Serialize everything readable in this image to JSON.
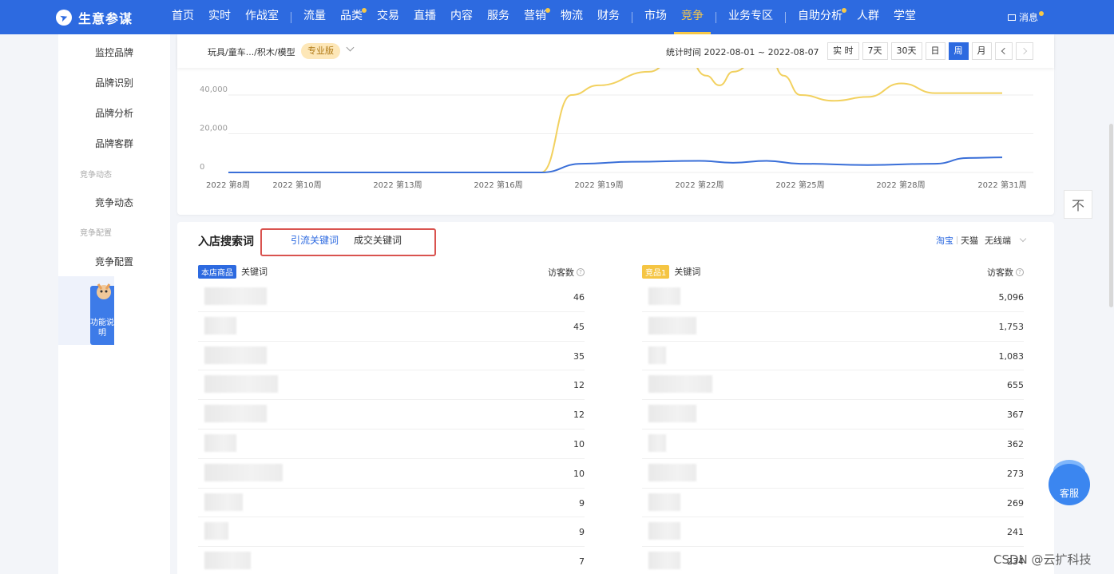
{
  "app": {
    "title": "生意参谋",
    "logo_icon": "compass-icon"
  },
  "nav": {
    "items": [
      {
        "label": "首页",
        "dot": false
      },
      {
        "label": "实时",
        "dot": false
      },
      {
        "label": "作战室",
        "dot": false
      },
      {
        "sep": true
      },
      {
        "label": "流量",
        "dot": false
      },
      {
        "label": "品类",
        "dot": true
      },
      {
        "label": "交易",
        "dot": false
      },
      {
        "label": "直播",
        "dot": false
      },
      {
        "label": "内容",
        "dot": false
      },
      {
        "label": "服务",
        "dot": false
      },
      {
        "label": "营销",
        "dot": true
      },
      {
        "label": "物流",
        "dot": false
      },
      {
        "label": "财务",
        "dot": false
      },
      {
        "sep": true
      },
      {
        "label": "市场",
        "dot": false
      },
      {
        "label": "竞争",
        "dot": false,
        "active": true
      },
      {
        "sep": true
      },
      {
        "label": "业务专区",
        "dot": false
      },
      {
        "sep": true
      },
      {
        "label": "自助分析",
        "dot": true
      },
      {
        "label": "人群",
        "dot": false
      },
      {
        "label": "学堂",
        "dot": false
      }
    ],
    "message_label": "消息",
    "accent": "#2d6ae0",
    "highlight": "#f7c948"
  },
  "sidebar": {
    "items": [
      "监控品牌",
      "品牌识别",
      "品牌分析",
      "品牌客群"
    ],
    "group_dynamics": "竞争动态",
    "dynamics_item": "竞争动态",
    "group_config": "竞争配置",
    "config_item": "竞争配置",
    "function_tab": "功能说明"
  },
  "filter": {
    "category": "玩具/童车.../积木/模型",
    "pro_badge": "专业版",
    "stat_time": "统计时间 2022-08-01 ~ 2022-08-07",
    "ranges": [
      "实 时",
      "7天",
      "30天",
      "日",
      "周",
      "月"
    ],
    "active_range": "周"
  },
  "chart_data": {
    "type": "line",
    "x": [
      "2022 第8周",
      "2022 第10周",
      "2022 第13周",
      "2022 第16周",
      "2022 第19周",
      "2022 第22周",
      "2022 第25周",
      "2022 第28周",
      "2022 第31周"
    ],
    "y_ticks": [
      "0",
      "20,000",
      "40,000"
    ],
    "ylim": [
      0,
      40000
    ],
    "grid": true,
    "series": [
      {
        "color": "#f2d15f",
        "points": [
          [
            8,
            0
          ],
          [
            17.3,
            0
          ],
          [
            18.2,
            40000
          ],
          [
            19,
            45000
          ],
          [
            20.5,
            52000
          ],
          [
            21.5,
            65000
          ],
          [
            22.2,
            50000
          ],
          [
            22.6,
            45000
          ],
          [
            23,
            52000
          ],
          [
            24,
            65000
          ],
          [
            24.5,
            50000
          ],
          [
            25,
            40000
          ],
          [
            26,
            37000
          ],
          [
            27,
            39000
          ],
          [
            28,
            46000
          ],
          [
            29,
            41000
          ],
          [
            31,
            41000
          ]
        ]
      },
      {
        "color": "#3a6fd8",
        "points": [
          [
            8,
            0
          ],
          [
            17.3,
            0
          ],
          [
            18.5,
            4500
          ],
          [
            20,
            5500
          ],
          [
            22,
            6000
          ],
          [
            23,
            5000
          ],
          [
            24,
            6000
          ],
          [
            25,
            4500
          ],
          [
            27,
            3800
          ],
          [
            29,
            4500
          ],
          [
            30,
            7500
          ],
          [
            31,
            7800
          ]
        ]
      }
    ]
  },
  "search_section": {
    "title": "入店搜索词",
    "tab_traffic": "引流关键词",
    "tab_deal": "成交关键词",
    "platform_taobao": "淘宝",
    "platform_tmall": "天猫",
    "platform_wireless": "无线端"
  },
  "left_table": {
    "tag": "本店商品",
    "col_keyword": "关键词",
    "col_visitors": "访客数",
    "values": [
      "46",
      "45",
      "35",
      "12",
      "12",
      "10",
      "10",
      "9",
      "9",
      "7"
    ]
  },
  "right_table": {
    "tag": "竞品1",
    "col_keyword": "关键词",
    "col_visitors": "访客数",
    "values": [
      "5,096",
      "1,753",
      "1,083",
      "655",
      "367",
      "362",
      "273",
      "269",
      "241",
      "234"
    ]
  },
  "floating": {
    "back_top": "不",
    "service": "客服"
  },
  "watermark": "CSDN @云扩科技"
}
